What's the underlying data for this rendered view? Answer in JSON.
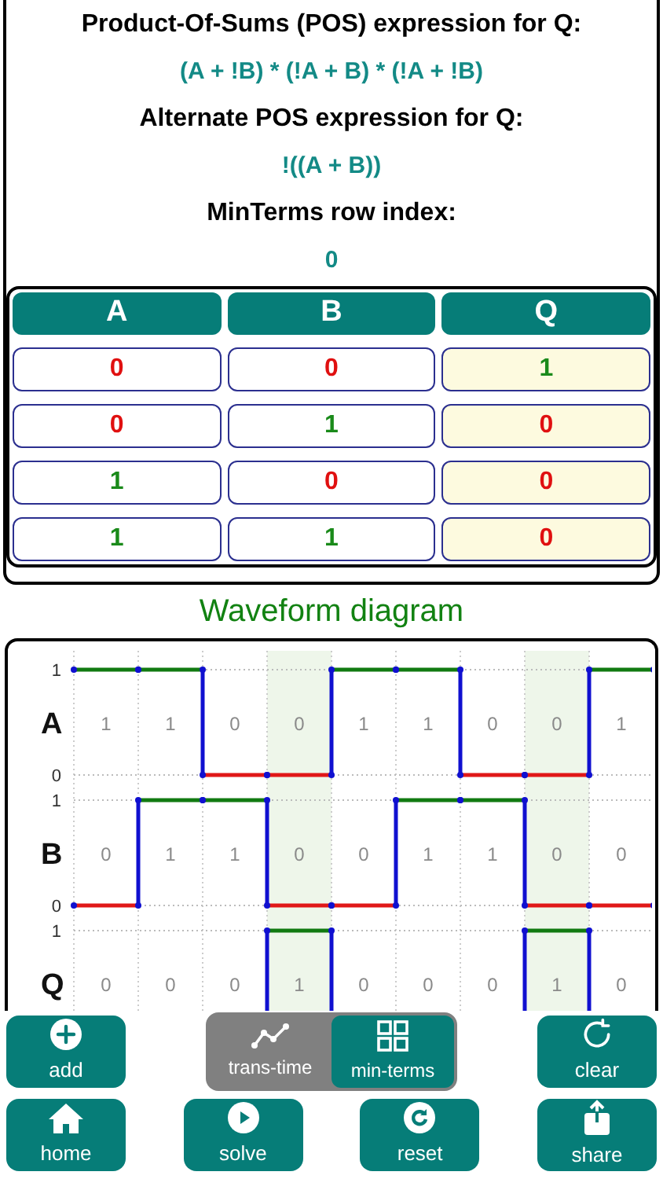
{
  "expressions": [
    {
      "kind": "heading",
      "text": "Product-Of-Sums (POS) expression for Q:"
    },
    {
      "kind": "value",
      "text": "(A + !B) * (!A + B) * (!A + !B)"
    },
    {
      "kind": "heading",
      "text": "Alternate POS expression for Q:"
    },
    {
      "kind": "value",
      "text": "!((A + B))"
    },
    {
      "kind": "heading",
      "text": "MinTerms row index:"
    },
    {
      "kind": "value",
      "text": "0"
    }
  ],
  "truth_table": {
    "columns": [
      {
        "label": "A",
        "kind": "input"
      },
      {
        "label": "B",
        "kind": "input"
      },
      {
        "label": "Q",
        "kind": "output"
      }
    ],
    "rows": [
      [
        {
          "text": "0",
          "color": "#e01010"
        },
        {
          "text": "0",
          "color": "#e01010"
        },
        {
          "text": "1",
          "color": "#1a8a1a"
        }
      ],
      [
        {
          "text": "0",
          "color": "#e01010"
        },
        {
          "text": "1",
          "color": "#1a8a1a"
        },
        {
          "text": "0",
          "color": "#e01010"
        }
      ],
      [
        {
          "text": "1",
          "color": "#1a8a1a"
        },
        {
          "text": "0",
          "color": "#e01010"
        },
        {
          "text": "0",
          "color": "#e01010"
        }
      ],
      [
        {
          "text": "1",
          "color": "#1a8a1a"
        },
        {
          "text": "1",
          "color": "#1a8a1a"
        },
        {
          "text": "0",
          "color": "#e01010"
        }
      ]
    ]
  },
  "waveform": {
    "title": "Waveform diagram",
    "highlighted": [
      false,
      false,
      false,
      true,
      false,
      false,
      false,
      true,
      false
    ],
    "signals": [
      {
        "name": "A",
        "high_label": "1",
        "low_label": "0",
        "values": [
          "1",
          "1",
          "0",
          "0",
          "1",
          "1",
          "0",
          "0",
          "1"
        ],
        "levels": [
          true,
          true,
          false,
          false,
          true,
          true,
          false,
          false,
          true
        ]
      },
      {
        "name": "B",
        "high_label": "1",
        "low_label": "0",
        "values": [
          "0",
          "1",
          "1",
          "0",
          "0",
          "1",
          "1",
          "0",
          "0"
        ],
        "levels": [
          false,
          true,
          true,
          false,
          false,
          true,
          true,
          false,
          false
        ]
      },
      {
        "name": "Q",
        "high_label": "1",
        "values": [
          "0",
          "0",
          "0",
          "1",
          "0",
          "0",
          "0",
          "1",
          "0"
        ],
        "levels": [
          false,
          false,
          false,
          true,
          false,
          false,
          false,
          true,
          false
        ]
      }
    ]
  },
  "toolbar_top": {
    "add": {
      "label": "add"
    },
    "modes": [
      {
        "label": "trans-time",
        "kind": "chart",
        "selected": false
      },
      {
        "label": "min-terms",
        "kind": "grid",
        "selected": true
      }
    ],
    "clear": {
      "label": "clear"
    }
  },
  "toolbar_bottom": [
    {
      "label": "home",
      "kind": "home"
    },
    {
      "label": "solve",
      "kind": "play"
    },
    {
      "label": "reset",
      "kind": "reset"
    },
    {
      "label": "share",
      "kind": "share"
    }
  ]
}
